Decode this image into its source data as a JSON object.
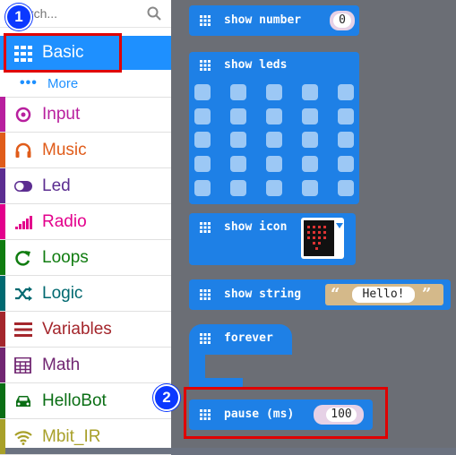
{
  "search": {
    "placeholder": "Search..."
  },
  "categories": [
    {
      "label": "Basic",
      "color": "#1e90ff"
    },
    {
      "label": "Input",
      "color": "#b81f9e"
    },
    {
      "label": "Music",
      "color": "#e05c1a"
    },
    {
      "label": "Led",
      "color": "#5c2d91"
    },
    {
      "label": "Radio",
      "color": "#e3008c"
    },
    {
      "label": "Loops",
      "color": "#107c10"
    },
    {
      "label": "Logic",
      "color": "#006970"
    },
    {
      "label": "Variables",
      "color": "#a4262c"
    },
    {
      "label": "Math",
      "color": "#712672"
    },
    {
      "label": "HelloBot",
      "color": "#0a6e14"
    },
    {
      "label": "Mbit_IR",
      "color": "#a8a029"
    }
  ],
  "more": {
    "label": "More",
    "dots": "•••"
  },
  "badges": {
    "first": "1",
    "second": "2"
  },
  "blocks": {
    "show_number": {
      "label": "show number",
      "value": "0"
    },
    "show_leds": {
      "label": "show leds"
    },
    "show_icon": {
      "label": "show icon"
    },
    "show_string": {
      "label": "show string",
      "value": "Hello!",
      "open_quote": "“",
      "close_quote": "”"
    },
    "forever": {
      "label": "forever"
    },
    "pause": {
      "label": "pause (ms)",
      "value": "100"
    }
  }
}
